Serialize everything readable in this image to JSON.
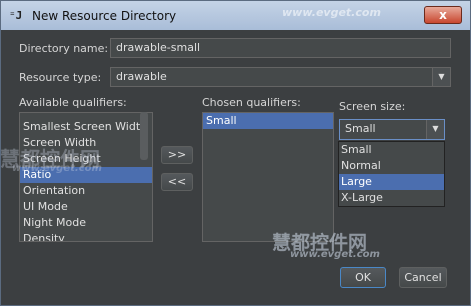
{
  "window": {
    "title": "New Resource Directory",
    "icon": "intellij-icon",
    "close_label": "x"
  },
  "form": {
    "directory_name_label": "Directory name:",
    "directory_name_value": "drawable-small",
    "resource_type_label": "Resource type:",
    "resource_type_value": "drawable"
  },
  "available": {
    "label": "Available qualifiers:",
    "items": [
      "Smallest Screen Width",
      "Screen Width",
      "Screen Height",
      "Ratio",
      "Orientation",
      "UI Mode",
      "Night Mode",
      "Density"
    ],
    "selected": "Ratio"
  },
  "buttons": {
    "add": ">>",
    "remove": "<<",
    "ok": "OK",
    "cancel": "Cancel"
  },
  "chosen": {
    "label": "Chosen qualifiers:",
    "items": [
      "Small"
    ]
  },
  "screen_size": {
    "label": "Screen size:",
    "value": "Small",
    "options": [
      "Small",
      "Normal",
      "Large",
      "X-Large"
    ],
    "highlighted": "Large"
  },
  "watermark": {
    "big": "慧都控件网",
    "url": "www.evget.com"
  }
}
